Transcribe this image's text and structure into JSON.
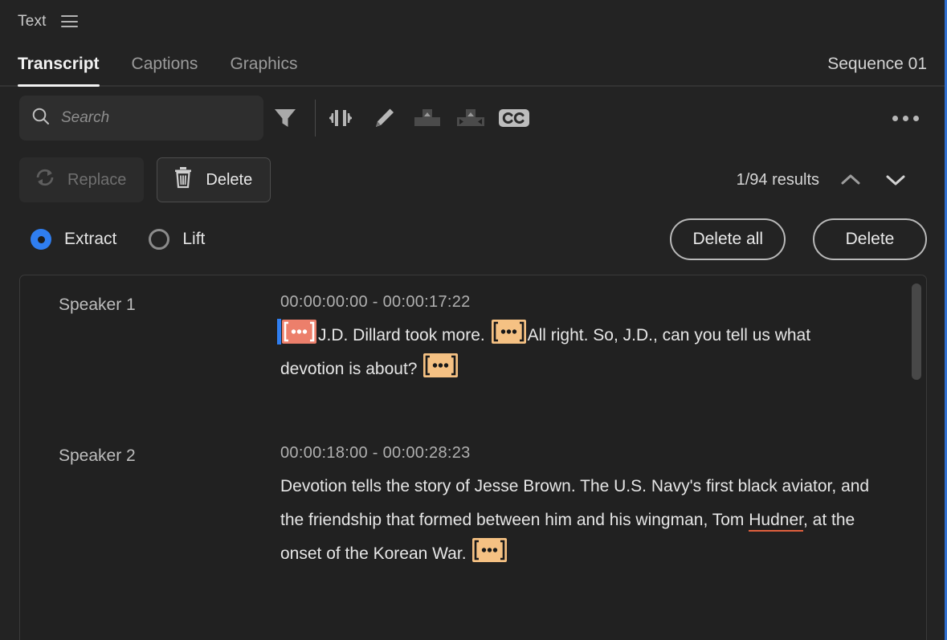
{
  "titlebar": {
    "label": "Text",
    "menu_icon": "hamburger-icon"
  },
  "tabs": [
    {
      "label": "Transcript",
      "active": true
    },
    {
      "label": "Captions",
      "active": false
    },
    {
      "label": "Graphics",
      "active": false
    }
  ],
  "sequence": {
    "name": "Sequence 01"
  },
  "search": {
    "placeholder": "Search",
    "value": "",
    "icon": "search-icon"
  },
  "toolbar_icons": [
    {
      "name": "filter-icon",
      "enabled": true
    },
    {
      "name": "pause-markers-icon",
      "enabled": true
    },
    {
      "name": "pencil-edit-icon",
      "enabled": true
    },
    {
      "name": "insert-clip-icon",
      "enabled": false
    },
    {
      "name": "trim-clip-icon",
      "enabled": false
    },
    {
      "name": "cc-captions-icon",
      "enabled": true
    },
    {
      "name": "more-options-icon",
      "enabled": true
    }
  ],
  "actions": {
    "replace_label": "Replace",
    "replace_icon": "refresh-icon",
    "replace_enabled": false,
    "delete_label": "Delete",
    "delete_icon": "trash-icon",
    "delete_enabled": true,
    "results_text": "1/94 results",
    "prev_icon": "chevron-up-icon",
    "next_icon": "chevron-down-icon"
  },
  "mode": {
    "extract_label": "Extract",
    "lift_label": "Lift",
    "selected": "Extract",
    "delete_all_label": "Delete all",
    "delete_label": "Delete"
  },
  "colors": {
    "accent_blue": "#2f7ef0",
    "panel_focus_border": "#2f6fd0",
    "token_orange": "#f5c183",
    "token_red": "#ec7f6b",
    "misspell_underline": "#e0603e",
    "panel_bg": "#232323",
    "list_bg": "#212121"
  },
  "transcript": [
    {
      "speaker": "Speaker 1",
      "timecode": "00:00:00:00 - 00:00:17:22",
      "segments": [
        {
          "type": "token",
          "style": "red",
          "cursor": true
        },
        {
          "type": "text",
          "text": "J.D. Dillard took more."
        },
        {
          "type": "token",
          "style": "orange",
          "cursor": false
        },
        {
          "type": "text",
          "text": "All right. So, J.D., can you tell us what devotion is about?"
        },
        {
          "type": "token",
          "style": "orange",
          "cursor": false
        }
      ]
    },
    {
      "speaker": "Speaker 2",
      "timecode": "00:00:18:00 - 00:00:28:23",
      "segments": [
        {
          "type": "text",
          "text": "Devotion tells the story of Jesse Brown. The U.S. Navy's first black aviator, and the friendship that formed between him and his wingman, Tom "
        },
        {
          "type": "misspell",
          "text": "Hudner"
        },
        {
          "type": "text",
          "text": ", at the onset of the Korean War."
        },
        {
          "type": "token",
          "style": "orange",
          "cursor": false
        }
      ]
    }
  ]
}
